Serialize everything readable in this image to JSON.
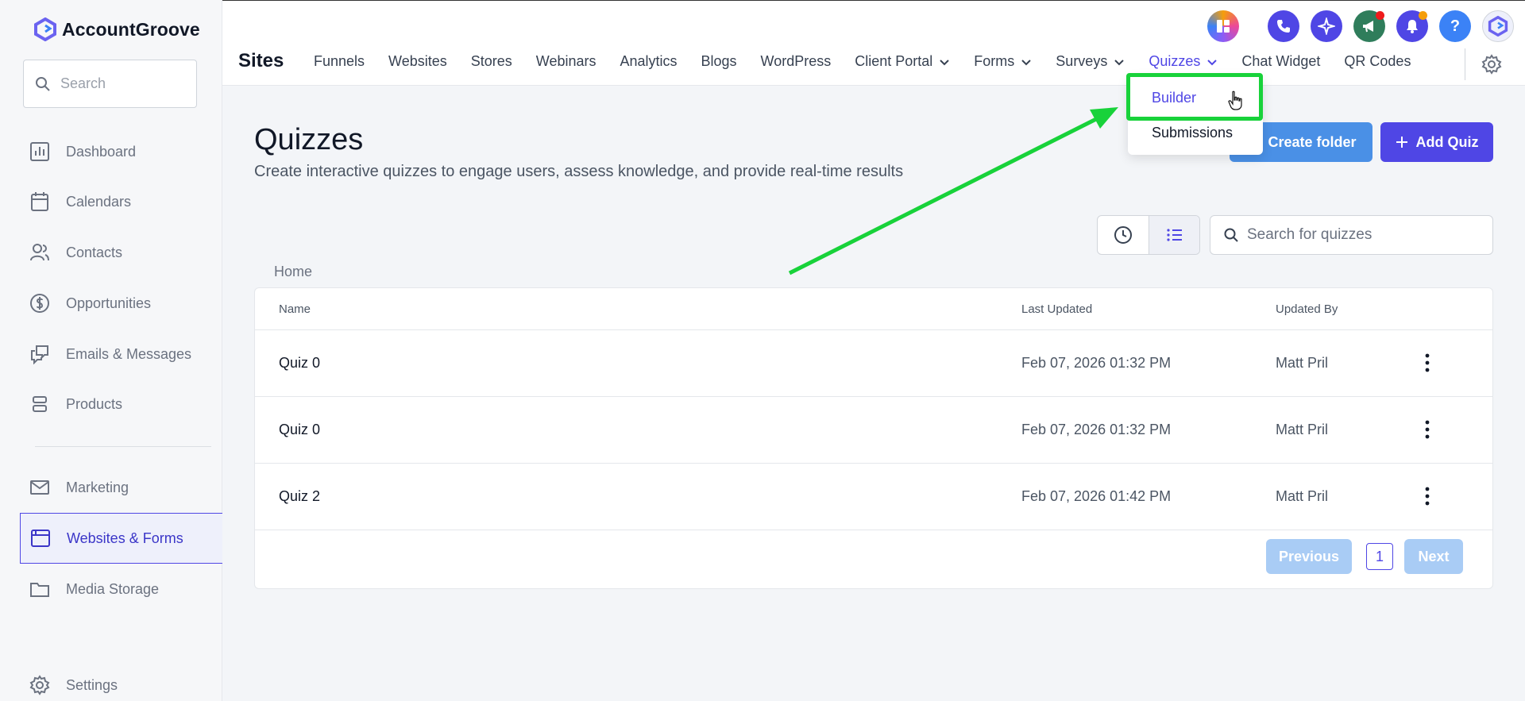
{
  "brand": {
    "name": "AccountGroove"
  },
  "sidebar": {
    "search_placeholder": "Search",
    "items": [
      {
        "label": "Dashboard",
        "icon": "chart-icon"
      },
      {
        "label": "Calendars",
        "icon": "calendar-icon"
      },
      {
        "label": "Contacts",
        "icon": "users-icon"
      },
      {
        "label": "Opportunities",
        "icon": "dollar-icon"
      },
      {
        "label": "Emails & Messages",
        "icon": "messages-icon"
      },
      {
        "label": "Products",
        "icon": "products-icon"
      },
      {
        "label": "Marketing",
        "icon": "mail-icon"
      },
      {
        "label": "Websites & Forms",
        "icon": "browser-icon",
        "active": true
      },
      {
        "label": "Media Storage",
        "icon": "folder-icon"
      },
      {
        "label": "Settings",
        "icon": "gear-icon"
      }
    ]
  },
  "topbar": {
    "section": "Sites",
    "tabs": [
      {
        "label": "Funnels"
      },
      {
        "label": "Websites"
      },
      {
        "label": "Stores"
      },
      {
        "label": "Webinars"
      },
      {
        "label": "Analytics"
      },
      {
        "label": "Blogs"
      },
      {
        "label": "WordPress"
      },
      {
        "label": "Client Portal",
        "dropdown": true
      },
      {
        "label": "Forms",
        "dropdown": true
      },
      {
        "label": "Surveys",
        "dropdown": true
      },
      {
        "label": "Quizzes",
        "dropdown": true,
        "active": true
      },
      {
        "label": "Chat Widget"
      },
      {
        "label": "QR Codes"
      }
    ],
    "help_label": "?"
  },
  "dropdown": {
    "items": [
      "Builder",
      "Submissions"
    ]
  },
  "page": {
    "title": "Quizzes",
    "subtitle": "Create interactive quizzes to engage users, assess knowledge, and provide real-time results",
    "create_folder": "Create folder",
    "add_quiz": "Add Quiz",
    "search_placeholder": "Search for quizzes",
    "breadcrumb": "Home"
  },
  "table": {
    "columns": [
      "Name",
      "Last Updated",
      "Updated By"
    ],
    "rows": [
      {
        "name": "Quiz 0",
        "updated": "Feb 07, 2026 01:32 PM",
        "by": "Matt Pril"
      },
      {
        "name": "Quiz 0",
        "updated": "Feb 07, 2026 01:32 PM",
        "by": "Matt Pril"
      },
      {
        "name": "Quiz 2",
        "updated": "Feb 07, 2026 01:42 PM",
        "by": "Matt Pril"
      }
    ]
  },
  "pager": {
    "prev": "Previous",
    "page": "1",
    "next": "Next"
  },
  "colors": {
    "accent": "#4f46e5",
    "highlight": "#18d23a",
    "blue_button": "#4a90e6"
  }
}
